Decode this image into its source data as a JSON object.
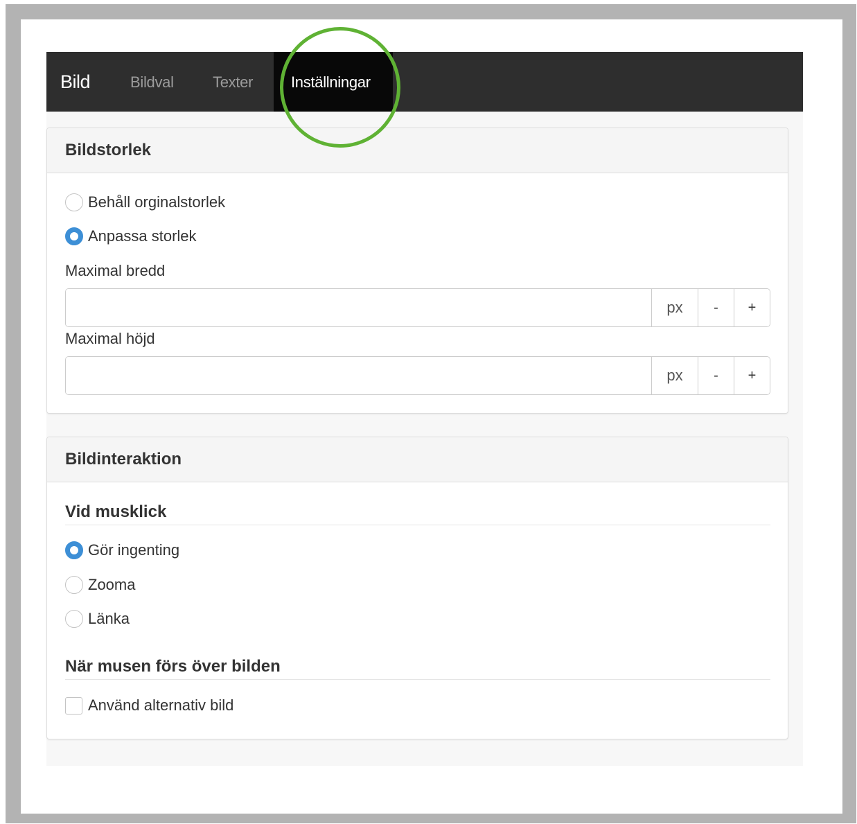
{
  "navbar": {
    "brand": "Bild",
    "tabs": [
      {
        "label": "Bildval",
        "active": false
      },
      {
        "label": "Texter",
        "active": false
      },
      {
        "label": "Inställningar",
        "active": true
      }
    ]
  },
  "highlight_color": "#5fb234",
  "image_size": {
    "heading": "Bildstorlek",
    "options": [
      {
        "label": "Behåll orginalstorlek",
        "checked": false
      },
      {
        "label": "Anpassa storlek",
        "checked": true
      }
    ],
    "max_width": {
      "label": "Maximal bredd",
      "value": "",
      "unit": "px",
      "minus": "-",
      "plus": "+"
    },
    "max_height": {
      "label": "Maximal höjd",
      "value": "",
      "unit": "px",
      "minus": "-",
      "plus": "+"
    }
  },
  "image_interaction": {
    "heading": "Bildinteraktion",
    "on_click": {
      "heading": "Vid musklick",
      "options": [
        {
          "label": "Gör ingenting",
          "checked": true
        },
        {
          "label": "Zooma",
          "checked": false
        },
        {
          "label": "Länka",
          "checked": false
        }
      ]
    },
    "on_hover": {
      "heading": "När musen förs över bilden",
      "checkbox_label": "Använd alternativ bild",
      "checked": false
    }
  },
  "colors": {
    "navbar_bg": "#2e2e2e",
    "active_tab_bg": "#080808",
    "radio_checked": "#3d8fd6"
  }
}
